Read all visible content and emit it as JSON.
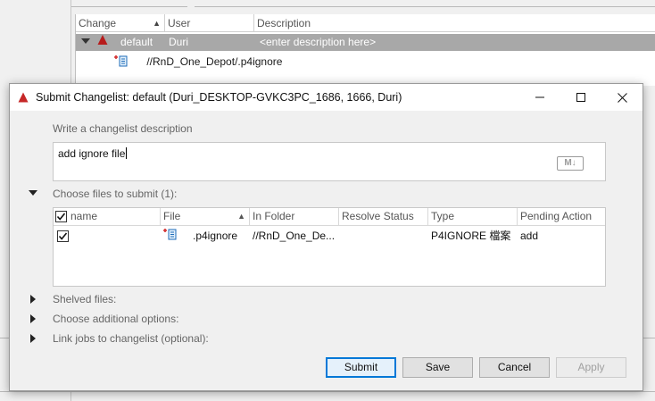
{
  "background": {
    "columns": [
      "Change",
      "User",
      "Description"
    ],
    "changelist": {
      "change": "default",
      "user": "Duri",
      "description": "<enter description here>"
    },
    "file_path": "//RnD_One_Depot/.p4ignore"
  },
  "dialog": {
    "title": "Submit Changelist: default (Duri_DESKTOP-GVKC3PC_1686,  1666,  Duri)",
    "description_label": "Write a changelist description",
    "description_value": "add ignore file",
    "markdown_badge": "M↓",
    "files_section_label": "Choose files to submit (1):",
    "files_table": {
      "headers": {
        "name": "name",
        "file": "File",
        "folder": "In Folder",
        "resolve": "Resolve Status",
        "type": "Type",
        "action": "Pending Action"
      },
      "rows": [
        {
          "checked": true,
          "file": ".p4ignore",
          "folder": "//RnD_One_De...",
          "resolve": "",
          "type": "P4IGNORE 檔案",
          "action": "add"
        }
      ]
    },
    "shelved_label": "Shelved files:",
    "options_label": "Choose additional options:",
    "jobs_label": "Link jobs to changelist (optional):",
    "buttons": {
      "submit": "Submit",
      "save": "Save",
      "cancel": "Cancel",
      "apply": "Apply"
    },
    "accent_color": "#0078d7",
    "brand_color": "#c62828"
  }
}
